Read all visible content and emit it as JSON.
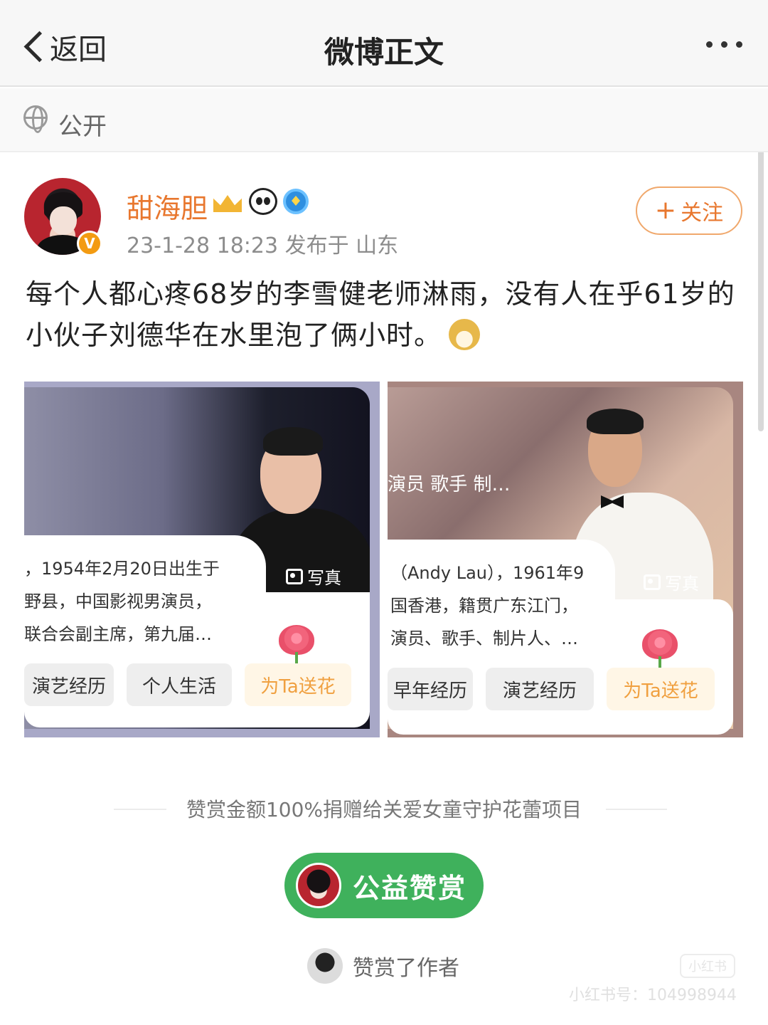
{
  "nav": {
    "back_label": "返回",
    "title": "微博正文"
  },
  "visibility": {
    "label": "公开"
  },
  "post": {
    "username": "甜海胆",
    "meta": "23-1-28 18:23  发布于 山东",
    "follow_label": "关注",
    "text": "每个人都心疼68岁的李雪健老师淋雨，没有人在乎61岁的小伙子刘德华在水里泡了俩小时。",
    "emoji": "doge-icon"
  },
  "cards": [
    {
      "photo_tag": "写真",
      "bio_lines": [
        "，1954年2月20日出生于",
        "野县，中国影视男演员，",
        "联合会副主席，第九届…"
      ],
      "buttons": [
        "演艺经历",
        "个人生活"
      ],
      "flower_label": "为Ta送花"
    },
    {
      "photo_tag": "写真",
      "role": "演员  歌手  制…",
      "bio_lines": [
        "（Andy Lau），1961年9",
        "国香港，籍贯广东江门，",
        "演员、歌手、制片人、…"
      ],
      "buttons": [
        "早年经历",
        "演艺经历"
      ],
      "flower_label": "为Ta送花"
    }
  ],
  "donation": {
    "note": "赞赏金额100%捐赠给关爱女童守护花蕾项目",
    "button_label": "公益赞赏",
    "supporter_text": "赞赏了作者"
  },
  "watermark": {
    "text": "小红书号：104998944",
    "logo": "小红书"
  },
  "colors": {
    "accent": "#e8772e",
    "tip_green": "#3fb15c"
  }
}
